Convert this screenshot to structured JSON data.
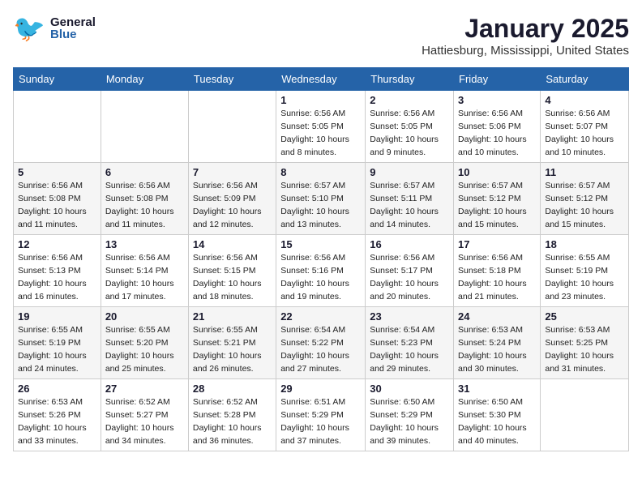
{
  "header": {
    "logo_general": "General",
    "logo_blue": "Blue",
    "title": "January 2025",
    "subtitle": "Hattiesburg, Mississippi, United States"
  },
  "days_of_week": [
    "Sunday",
    "Monday",
    "Tuesday",
    "Wednesday",
    "Thursday",
    "Friday",
    "Saturday"
  ],
  "weeks": [
    [
      {
        "day": "",
        "info": ""
      },
      {
        "day": "",
        "info": ""
      },
      {
        "day": "",
        "info": ""
      },
      {
        "day": "1",
        "info": "Sunrise: 6:56 AM\nSunset: 5:05 PM\nDaylight: 10 hours\nand 8 minutes."
      },
      {
        "day": "2",
        "info": "Sunrise: 6:56 AM\nSunset: 5:05 PM\nDaylight: 10 hours\nand 9 minutes."
      },
      {
        "day": "3",
        "info": "Sunrise: 6:56 AM\nSunset: 5:06 PM\nDaylight: 10 hours\nand 10 minutes."
      },
      {
        "day": "4",
        "info": "Sunrise: 6:56 AM\nSunset: 5:07 PM\nDaylight: 10 hours\nand 10 minutes."
      }
    ],
    [
      {
        "day": "5",
        "info": "Sunrise: 6:56 AM\nSunset: 5:08 PM\nDaylight: 10 hours\nand 11 minutes."
      },
      {
        "day": "6",
        "info": "Sunrise: 6:56 AM\nSunset: 5:08 PM\nDaylight: 10 hours\nand 11 minutes."
      },
      {
        "day": "7",
        "info": "Sunrise: 6:56 AM\nSunset: 5:09 PM\nDaylight: 10 hours\nand 12 minutes."
      },
      {
        "day": "8",
        "info": "Sunrise: 6:57 AM\nSunset: 5:10 PM\nDaylight: 10 hours\nand 13 minutes."
      },
      {
        "day": "9",
        "info": "Sunrise: 6:57 AM\nSunset: 5:11 PM\nDaylight: 10 hours\nand 14 minutes."
      },
      {
        "day": "10",
        "info": "Sunrise: 6:57 AM\nSunset: 5:12 PM\nDaylight: 10 hours\nand 15 minutes."
      },
      {
        "day": "11",
        "info": "Sunrise: 6:57 AM\nSunset: 5:12 PM\nDaylight: 10 hours\nand 15 minutes."
      }
    ],
    [
      {
        "day": "12",
        "info": "Sunrise: 6:56 AM\nSunset: 5:13 PM\nDaylight: 10 hours\nand 16 minutes."
      },
      {
        "day": "13",
        "info": "Sunrise: 6:56 AM\nSunset: 5:14 PM\nDaylight: 10 hours\nand 17 minutes."
      },
      {
        "day": "14",
        "info": "Sunrise: 6:56 AM\nSunset: 5:15 PM\nDaylight: 10 hours\nand 18 minutes."
      },
      {
        "day": "15",
        "info": "Sunrise: 6:56 AM\nSunset: 5:16 PM\nDaylight: 10 hours\nand 19 minutes."
      },
      {
        "day": "16",
        "info": "Sunrise: 6:56 AM\nSunset: 5:17 PM\nDaylight: 10 hours\nand 20 minutes."
      },
      {
        "day": "17",
        "info": "Sunrise: 6:56 AM\nSunset: 5:18 PM\nDaylight: 10 hours\nand 21 minutes."
      },
      {
        "day": "18",
        "info": "Sunrise: 6:55 AM\nSunset: 5:19 PM\nDaylight: 10 hours\nand 23 minutes."
      }
    ],
    [
      {
        "day": "19",
        "info": "Sunrise: 6:55 AM\nSunset: 5:19 PM\nDaylight: 10 hours\nand 24 minutes."
      },
      {
        "day": "20",
        "info": "Sunrise: 6:55 AM\nSunset: 5:20 PM\nDaylight: 10 hours\nand 25 minutes."
      },
      {
        "day": "21",
        "info": "Sunrise: 6:55 AM\nSunset: 5:21 PM\nDaylight: 10 hours\nand 26 minutes."
      },
      {
        "day": "22",
        "info": "Sunrise: 6:54 AM\nSunset: 5:22 PM\nDaylight: 10 hours\nand 27 minutes."
      },
      {
        "day": "23",
        "info": "Sunrise: 6:54 AM\nSunset: 5:23 PM\nDaylight: 10 hours\nand 29 minutes."
      },
      {
        "day": "24",
        "info": "Sunrise: 6:53 AM\nSunset: 5:24 PM\nDaylight: 10 hours\nand 30 minutes."
      },
      {
        "day": "25",
        "info": "Sunrise: 6:53 AM\nSunset: 5:25 PM\nDaylight: 10 hours\nand 31 minutes."
      }
    ],
    [
      {
        "day": "26",
        "info": "Sunrise: 6:53 AM\nSunset: 5:26 PM\nDaylight: 10 hours\nand 33 minutes."
      },
      {
        "day": "27",
        "info": "Sunrise: 6:52 AM\nSunset: 5:27 PM\nDaylight: 10 hours\nand 34 minutes."
      },
      {
        "day": "28",
        "info": "Sunrise: 6:52 AM\nSunset: 5:28 PM\nDaylight: 10 hours\nand 36 minutes."
      },
      {
        "day": "29",
        "info": "Sunrise: 6:51 AM\nSunset: 5:29 PM\nDaylight: 10 hours\nand 37 minutes."
      },
      {
        "day": "30",
        "info": "Sunrise: 6:50 AM\nSunset: 5:29 PM\nDaylight: 10 hours\nand 39 minutes."
      },
      {
        "day": "31",
        "info": "Sunrise: 6:50 AM\nSunset: 5:30 PM\nDaylight: 10 hours\nand 40 minutes."
      },
      {
        "day": "",
        "info": ""
      }
    ]
  ]
}
